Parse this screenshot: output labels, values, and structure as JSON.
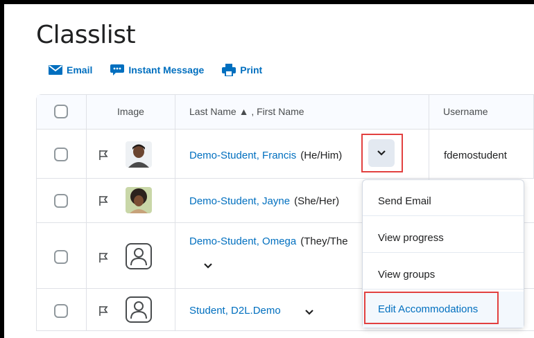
{
  "page": {
    "title": "Classlist"
  },
  "toolbar": {
    "email": "Email",
    "instant_message": "Instant Message",
    "print": "Print"
  },
  "table": {
    "headers": {
      "image": "Image",
      "name_sort": "Last Name ▲ , First Name",
      "username": "Username"
    },
    "rows": [
      {
        "name": "Demo-Student, Francis",
        "pronouns": "(He/Him)",
        "username": "fdemostudent"
      },
      {
        "name": "Demo-Student, Jayne",
        "pronouns": "(She/Her)",
        "username": ""
      },
      {
        "name": "Demo-Student, Omega",
        "pronouns": "(They/The",
        "username": ""
      },
      {
        "name": "Student, D2L.Demo",
        "pronouns": "",
        "username": ""
      }
    ]
  },
  "context_menu": {
    "items": [
      "Send Email",
      "View progress",
      "View groups",
      "Edit Accommodations"
    ],
    "selected": "Edit Accommodations"
  },
  "colors": {
    "link": "#006fbf",
    "highlight": "#e2403f"
  },
  "icons": [
    "envelope-icon",
    "chat-bubble-icon",
    "printer-icon",
    "flag-icon",
    "chevron-down-icon",
    "user-placeholder-icon"
  ]
}
